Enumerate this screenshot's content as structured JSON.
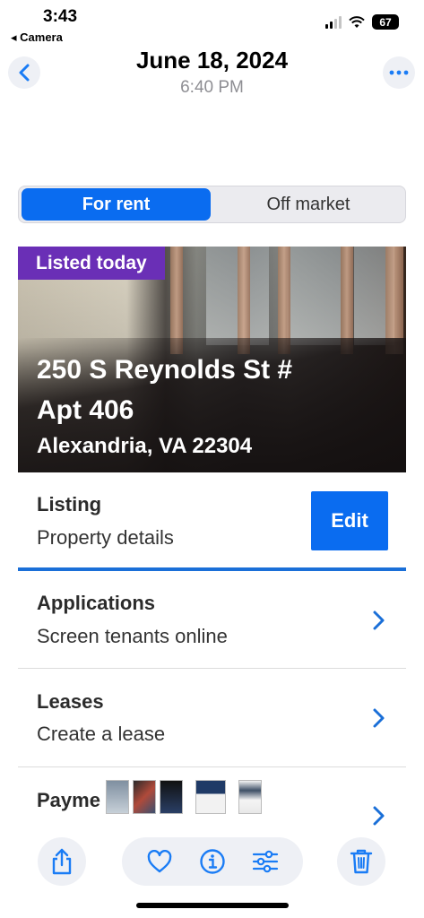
{
  "status_bar": {
    "time": "3:43",
    "back_app": "◂ Camera",
    "battery": "67"
  },
  "photo_header": {
    "date": "June 18, 2024",
    "time": "6:40 PM"
  },
  "segmented": {
    "active_label": "For rent",
    "inactive_label": "Off market"
  },
  "listing_card": {
    "badge": "Listed today",
    "address_line1": "250 S Reynolds St #",
    "address_line2": "Apt 406",
    "address_line3": "Alexandria, VA 22304"
  },
  "rows": {
    "listing": {
      "title": "Listing",
      "subtitle": "Property details",
      "button": "Edit"
    },
    "applications": {
      "title": "Applications",
      "subtitle": "Screen tenants online"
    },
    "leases": {
      "title": "Leases",
      "subtitle": "Create a lease"
    },
    "payments": {
      "title": "Payme"
    }
  },
  "colors": {
    "accent": "#0a6cf0",
    "badge": "#6a2fb6",
    "ios_blue": "#1a7cf5"
  },
  "icons": [
    "chevron-left-icon",
    "more-icon",
    "chevron-right-icon",
    "share-icon",
    "heart-icon",
    "info-icon",
    "adjust-icon",
    "trash-icon"
  ]
}
